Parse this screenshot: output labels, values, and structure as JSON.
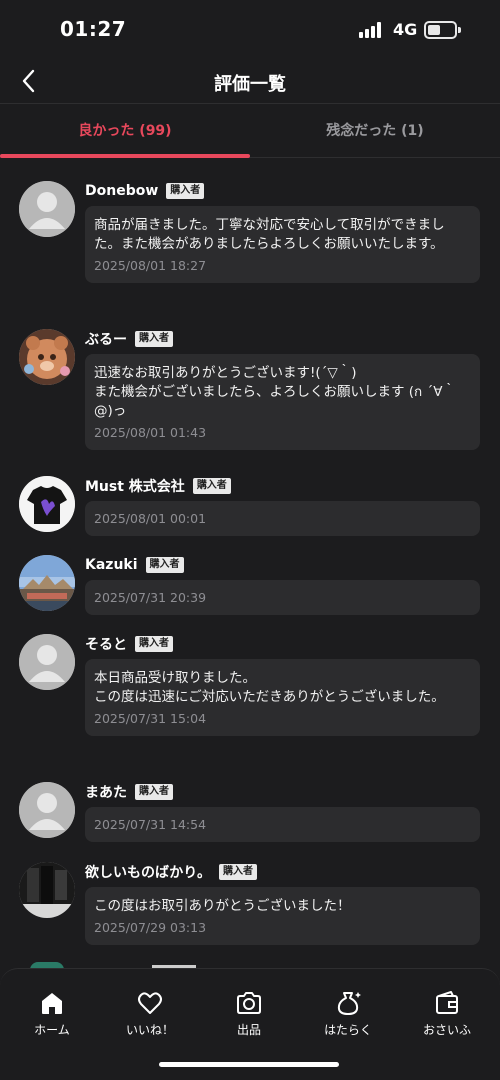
{
  "status_bar": {
    "time": "01:27",
    "network": "4G"
  },
  "header": {
    "title": "評価一覧"
  },
  "tabs": [
    {
      "label": "良かった (99)",
      "active": true
    },
    {
      "label": "残念だった (1)",
      "active": false
    }
  ],
  "colors": {
    "accent": "#e8485c",
    "background": "#1c1c1e",
    "bubble": "#2c2c2e",
    "badge": "#e9e9e9"
  },
  "reviews": [
    {
      "name": "Donebow",
      "badge": "購入者",
      "avatar": "default-avatar-icon",
      "text": "商品が届きました。丁寧な対応で安心して取引ができました。また機会がありましたらよろしくお願いいたします。",
      "date": "2025/08/01 18:27"
    },
    {
      "name": "ぶるー",
      "badge": "購入者",
      "avatar": "bear-photo-avatar",
      "text": "迅速なお取引ありがとうございます!(´▽｀)\nまた機会がございましたら、よろしくお願いします (ก ´∀｀@)っ",
      "date": "2025/08/01 01:43"
    },
    {
      "name": "Must 株式会社",
      "badge": "購入者",
      "avatar": "tshirt-photo-avatar",
      "text": "",
      "date": "2025/08/01 00:01"
    },
    {
      "name": "Kazuki",
      "badge": "購入者",
      "avatar": "landscape-photo-avatar",
      "text": "",
      "date": "2025/07/31 20:39"
    },
    {
      "name": "そると",
      "badge": "購入者",
      "avatar": "default-avatar-icon",
      "text": "本日商品受け取りました。\nこの度は迅速にご対応いただきありがとうございました。",
      "date": "2025/07/31 15:04"
    },
    {
      "name": "まあた",
      "badge": "購入者",
      "avatar": "default-avatar-icon",
      "text": "",
      "date": "2025/07/31 14:54"
    },
    {
      "name": "欲しいものばかり。",
      "badge": "購入者",
      "avatar": "clothes-photo-avatar",
      "text": "この度はお取引ありがとうございました！",
      "date": "2025/07/29 03:13"
    }
  ],
  "bottom_nav": [
    {
      "label": "ホーム",
      "icon": "home-icon"
    },
    {
      "label": "いいね！",
      "icon": "heart-icon"
    },
    {
      "label": "出品",
      "icon": "camera-icon"
    },
    {
      "label": "はたらく",
      "icon": "money-bag-icon"
    },
    {
      "label": "おさいふ",
      "icon": "wallet-icon"
    }
  ]
}
